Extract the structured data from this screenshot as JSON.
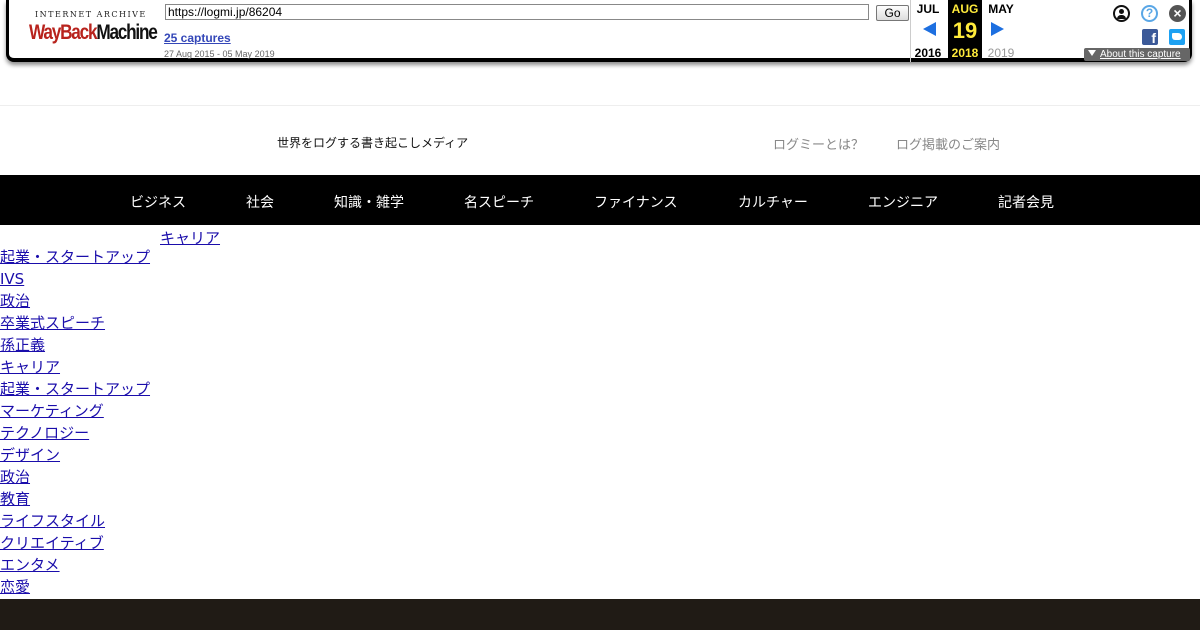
{
  "wayback": {
    "logo_top": "INTERNET ARCHIVE",
    "logo_main_red": "WayBack",
    "logo_main_dark": "Machine",
    "url": "https://logmi.jp/86204",
    "go_label": "Go",
    "captures": "25 captures",
    "range": "27 Aug 2015 - 05 May 2019",
    "prev": {
      "month": "JUL",
      "year": "2016"
    },
    "current": {
      "month": "AUG",
      "day": "19",
      "year": "2018"
    },
    "next": {
      "month": "MAY",
      "year": "2019"
    },
    "help_glyph": "?",
    "close_glyph": "×",
    "facebook_glyph": "f",
    "about_capture": "About this capture",
    "icons": [
      "user-icon",
      "help-icon",
      "close-icon",
      "facebook-icon",
      "twitter-icon",
      "chevron-down-icon",
      "arrow-left-icon",
      "arrow-right-icon"
    ]
  },
  "header": {
    "tagline": "世界をログする書き起こしメディア",
    "links": [
      "ログミーとは？",
      "ログ掲載のご案内"
    ]
  },
  "categories": [
    "ビジネス",
    "社会",
    "知識・雑学",
    "名スピーチ",
    "ファイナンス",
    "カルチャー",
    "エンジニア",
    "記者会見"
  ],
  "subcategory_first": "キャリア",
  "subcategories": [
    "起業・スタートアップ",
    "IVS",
    "政治",
    "卒業式スピーチ",
    "孫正義",
    "キャリア",
    "起業・スタートアップ",
    "マーケティング",
    "テクノロジー",
    "デザイン",
    "政治",
    "教育",
    "ライフスタイル",
    "クリエイティブ",
    "エンタメ",
    "恋愛"
  ],
  "colors": {
    "nav_bg": "#000000",
    "link": "#1a0dab",
    "wayback_highlight": "#ffeb3b",
    "footer_bg": "#201b15"
  }
}
